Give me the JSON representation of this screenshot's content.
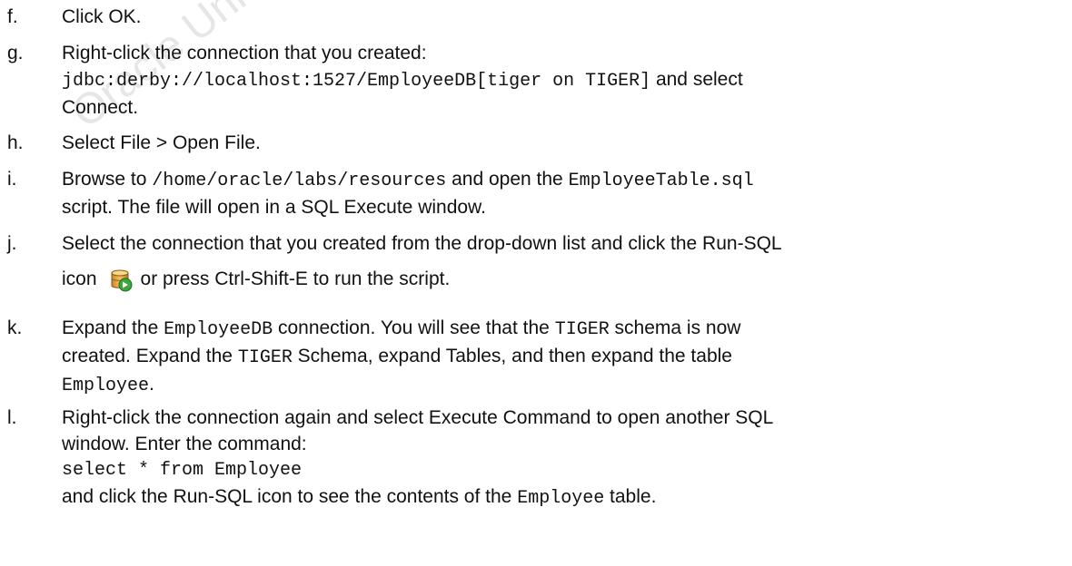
{
  "watermark": {
    "text": "Oracle University and"
  },
  "steps": {
    "f": {
      "marker": "f.",
      "text": "Click OK."
    },
    "g": {
      "marker": "g.",
      "line1": "Right-click the connection that you created:",
      "code": "jdbc:derby://localhost:1527/EmployeeDB[tiger on TIGER]",
      "after_code": " and select",
      "line3": "Connect."
    },
    "h": {
      "marker": "h.",
      "text": "Select File > Open File."
    },
    "i": {
      "marker": "i.",
      "t1": "Browse to ",
      "path": "/home/oracle/labs/resources",
      "t2": "  and open the ",
      "file": "EmployeeTable.sql",
      "line2": "script. The file will open in a SQL Execute window."
    },
    "j": {
      "marker": "j.",
      "line1": "Select the connection that you created from the drop-down list and click the Run-SQL",
      "t_icon": "icon",
      "icon": "run-sql-icon",
      "t_after": "or press Ctrl-Shift-E to run the script."
    },
    "k": {
      "marker": "k.",
      "t1": "Expand the ",
      "db": "EmployeeDB",
      "t2": " connection. You will see that the ",
      "schema": "TIGER",
      "t3": "  schema is now",
      "t4": "created. Expand the ",
      "schema2": "TIGER",
      "t5": " Schema, expand Tables, and then expand the table",
      "table": "Employee",
      "t6": "."
    },
    "l": {
      "marker": "l.",
      "line1": "Right-click the connection again and select Execute Command to open another SQL",
      "line2": "window. Enter the command:",
      "cmd": "select * from Employee",
      "t1": "and click the Run-SQL icon to see the contents of the ",
      "table": "Employee",
      "t2": " table."
    }
  }
}
